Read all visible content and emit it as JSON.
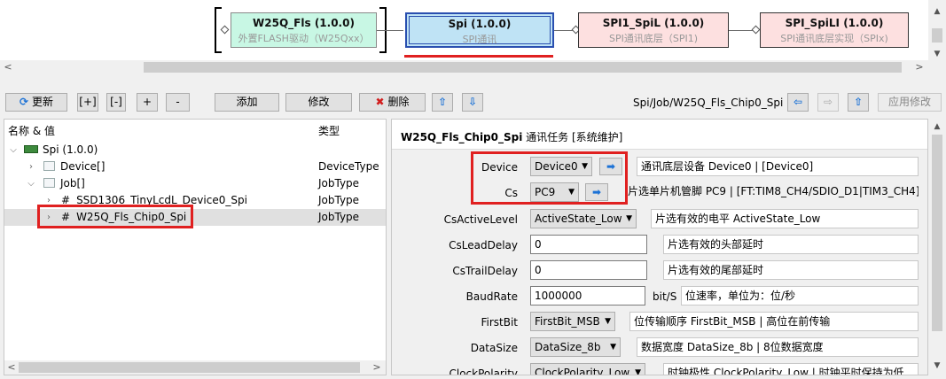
{
  "diagram": {
    "nodes": [
      {
        "title": "W25Q_Fls (1.0.0)",
        "subtitle": "外置FLASH驱动（W25Qxx）",
        "bg": "#c8f7e4"
      },
      {
        "title": "Spi (1.0.0)",
        "subtitle": "SPI通讯",
        "bg": "#bfe3f5"
      },
      {
        "title": "SPI1_SpiL (1.0.0)",
        "subtitle": "SPI通讯底层（SPI1)",
        "bg": "#fde0e0"
      },
      {
        "title": "SPI_SpiLI (1.0.0)",
        "subtitle": "SPI通讯底层实现（SPIx)",
        "bg": "#fde0e0"
      }
    ]
  },
  "toolbar": {
    "refresh": "更新",
    "expand_all": "[+]",
    "collapse_all": "[-]",
    "expand": "+",
    "collapse": "-",
    "add": "添加",
    "modify": "修改",
    "delete": "删除",
    "path": "Spi/Job/W25Q_Fls_Chip0_Spi",
    "apply": "应用修改"
  },
  "tree": {
    "col_name": "名称 & 值",
    "col_type": "类型",
    "rows": [
      {
        "name": "Spi (1.0.0)",
        "type": ""
      },
      {
        "name": "Device[]",
        "type": "DeviceType"
      },
      {
        "name": "Job[]",
        "type": "JobType"
      },
      {
        "name": "SSD1306_TinyLcdL_Device0_Spi",
        "type": "JobType"
      },
      {
        "name": "W25Q_Fls_Chip0_Spi",
        "type": "JobType"
      }
    ]
  },
  "detail": {
    "title_bold": "W25Q_Fls_Chip0_Spi",
    "title_rest": "通讯任务 [系统维护]",
    "fields": [
      {
        "label": "Device",
        "value": "Device0",
        "desc": "通讯底层设备 Device0 | [Device0]"
      },
      {
        "label": "Cs",
        "value": "PC9",
        "desc": "片选单片机管脚 PC9 | [FT:TIM8_CH4/SDIO_D1|TIM3_CH4]"
      },
      {
        "label": "CsActiveLevel",
        "value": "ActiveState_Low",
        "desc": "片选有效的电平 ActiveState_Low"
      },
      {
        "label": "CsLeadDelay",
        "value": "0",
        "desc": "片选有效的头部延时"
      },
      {
        "label": "CsTrailDelay",
        "value": "0",
        "desc": "片选有效的尾部延时"
      },
      {
        "label": "BaudRate",
        "value": "1000000",
        "unit": "bit/S",
        "desc": "位速率，单位为：位/秒"
      },
      {
        "label": "FirstBit",
        "value": "FirstBit_MSB",
        "desc": "位传输顺序 FirstBit_MSB | 高位在前传输"
      },
      {
        "label": "DataSize",
        "value": "DataSize_8b",
        "desc": "数据宽度 DataSize_8b | 8位数据宽度"
      },
      {
        "label": "ClockPolarity",
        "value": "ClockPolarity_Low",
        "desc": "时钟极性 ClockPolarity_Low | 时钟平时保持为低"
      }
    ]
  }
}
